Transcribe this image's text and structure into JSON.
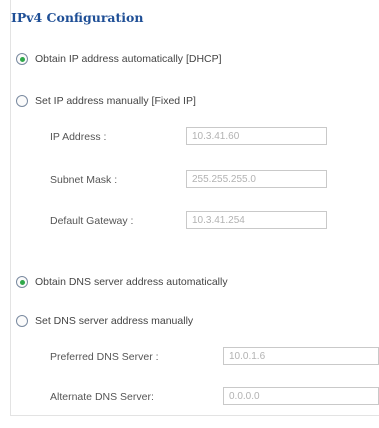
{
  "title": "IPv4 Configuration",
  "ip": {
    "auto_label": "Obtain IP address automatically [DHCP]",
    "manual_label": "Set IP address manually [Fixed IP]",
    "mode": "auto",
    "fields": {
      "ip_address": {
        "label": "IP Address :",
        "value": "10.3.41.60"
      },
      "subnet_mask": {
        "label": "Subnet Mask :",
        "value": "255.255.255.0"
      },
      "default_gateway": {
        "label": "Default Gateway :",
        "value": "10.3.41.254"
      }
    }
  },
  "dns": {
    "auto_label": "Obtain DNS server address automatically",
    "manual_label": "Set DNS server address manually",
    "mode": "auto",
    "fields": {
      "preferred": {
        "label": "Preferred DNS Server :",
        "value": "10.0.1.6"
      },
      "alternate": {
        "label": "Alternate DNS Server:",
        "value": "0.0.0.0"
      }
    }
  },
  "colors": {
    "title": "#1f4f96",
    "radio_selected": "#2fa84a",
    "disabled_text": "#b2b2b2"
  }
}
